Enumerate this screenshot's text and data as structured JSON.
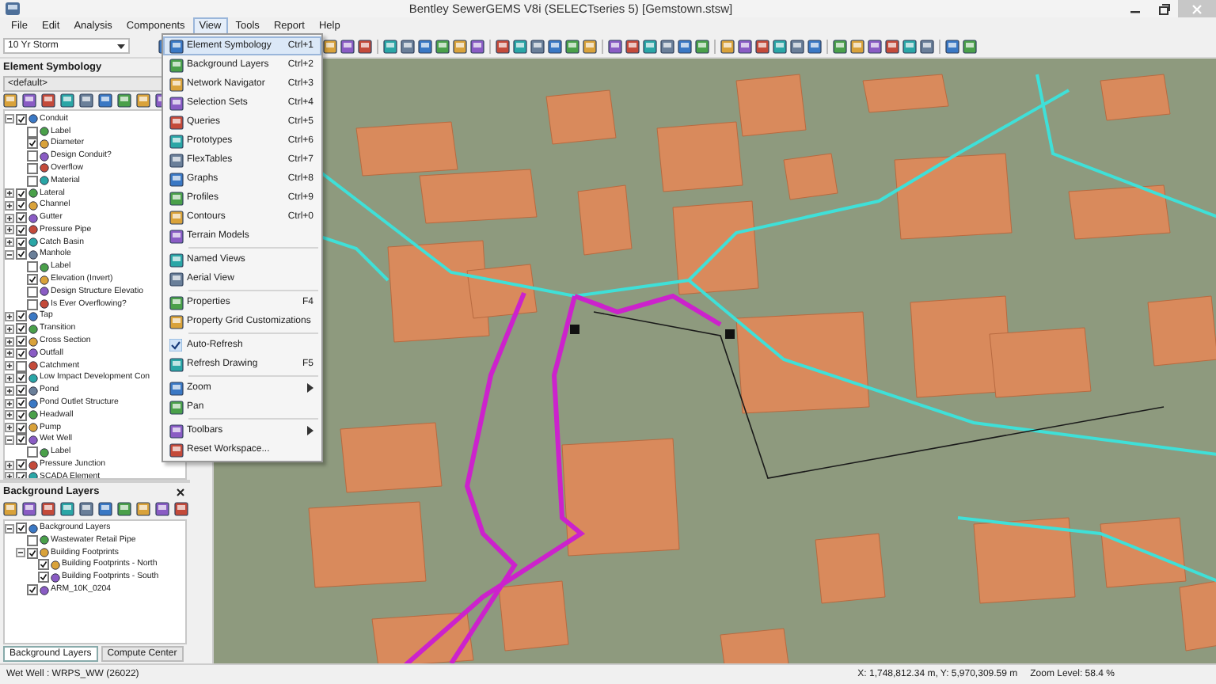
{
  "window": {
    "title": "Bentley SewerGEMS V8i (SELECTseries 5) [Gemstown.stsw]"
  },
  "menu_bar": [
    {
      "label": "File",
      "selected": false
    },
    {
      "label": "Edit",
      "selected": false
    },
    {
      "label": "Analysis",
      "selected": false
    },
    {
      "label": "Components",
      "selected": false
    },
    {
      "label": "View",
      "selected": true
    },
    {
      "label": "Tools",
      "selected": false
    },
    {
      "label": "Report",
      "selected": false
    },
    {
      "label": "Help",
      "selected": false
    }
  ],
  "scenario": {
    "value": "10 Yr Storm"
  },
  "view_menu": [
    {
      "kind": "item",
      "label": "Element Symbology",
      "shortcut": "Ctrl+1",
      "selected": true,
      "checked": false,
      "submenu": false
    },
    {
      "kind": "item",
      "label": "Background Layers",
      "shortcut": "Ctrl+2",
      "selected": false,
      "checked": false,
      "submenu": false
    },
    {
      "kind": "item",
      "label": "Network Navigator",
      "shortcut": "Ctrl+3",
      "selected": false,
      "checked": false,
      "submenu": false
    },
    {
      "kind": "item",
      "label": "Selection Sets",
      "shortcut": "Ctrl+4",
      "selected": false,
      "checked": false,
      "submenu": false
    },
    {
      "kind": "item",
      "label": "Queries",
      "shortcut": "Ctrl+5",
      "selected": false,
      "checked": false,
      "submenu": false
    },
    {
      "kind": "item",
      "label": "Prototypes",
      "shortcut": "Ctrl+6",
      "selected": false,
      "checked": false,
      "submenu": false
    },
    {
      "kind": "item",
      "label": "FlexTables",
      "shortcut": "Ctrl+7",
      "selected": false,
      "checked": false,
      "submenu": false
    },
    {
      "kind": "item",
      "label": "Graphs",
      "shortcut": "Ctrl+8",
      "selected": false,
      "checked": false,
      "submenu": false
    },
    {
      "kind": "item",
      "label": "Profiles",
      "shortcut": "Ctrl+9",
      "selected": false,
      "checked": false,
      "submenu": false
    },
    {
      "kind": "item",
      "label": "Contours",
      "shortcut": "Ctrl+0",
      "selected": false,
      "checked": false,
      "submenu": false
    },
    {
      "kind": "item",
      "label": "Terrain Models",
      "selected": false,
      "checked": false,
      "submenu": false
    },
    {
      "kind": "separator"
    },
    {
      "kind": "item",
      "label": "Named Views",
      "selected": false,
      "checked": false,
      "submenu": false
    },
    {
      "kind": "item",
      "label": "Aerial View",
      "selected": false,
      "checked": false,
      "submenu": false
    },
    {
      "kind": "separator"
    },
    {
      "kind": "item",
      "label": "Properties",
      "shortcut": "F4",
      "selected": false,
      "checked": false,
      "submenu": false
    },
    {
      "kind": "item",
      "label": "Property Grid Customizations",
      "selected": false,
      "checked": false,
      "submenu": false
    },
    {
      "kind": "separator"
    },
    {
      "kind": "item",
      "label": "Auto-Refresh",
      "selected": false,
      "checked": true,
      "submenu": false
    },
    {
      "kind": "item",
      "label": "Refresh Drawing",
      "shortcut": "F5",
      "selected": false,
      "checked": false,
      "submenu": false
    },
    {
      "kind": "separator"
    },
    {
      "kind": "item",
      "label": "Zoom",
      "selected": false,
      "checked": false,
      "submenu": true
    },
    {
      "kind": "item",
      "label": "Pan",
      "selected": false,
      "checked": false,
      "submenu": false
    },
    {
      "kind": "separator"
    },
    {
      "kind": "item",
      "label": "Toolbars",
      "selected": false,
      "checked": false,
      "submenu": true
    },
    {
      "kind": "item",
      "label": "Reset Workspace...",
      "selected": false,
      "checked": false,
      "submenu": false
    }
  ],
  "element_symbology": {
    "title": "Element Symbology",
    "dropdown": {
      "value": "<default>"
    },
    "tree": [
      {
        "label": "Conduit",
        "checked": true,
        "expanded": true,
        "children": [
          {
            "label": "Label",
            "checked": false
          },
          {
            "label": "Diameter",
            "checked": true
          },
          {
            "label": "Design Conduit?",
            "checked": false
          },
          {
            "label": "Overflow",
            "checked": false
          },
          {
            "label": "Material",
            "checked": false
          }
        ]
      },
      {
        "label": "Lateral",
        "checked": true,
        "expanded": false
      },
      {
        "label": "Channel",
        "checked": true,
        "expanded": false
      },
      {
        "label": "Gutter",
        "checked": true,
        "expanded": false
      },
      {
        "label": "Pressure Pipe",
        "checked": true,
        "expanded": false
      },
      {
        "label": "Catch Basin",
        "checked": true,
        "expanded": false
      },
      {
        "label": "Manhole",
        "checked": true,
        "expanded": true,
        "children": [
          {
            "label": "Label",
            "checked": false
          },
          {
            "label": "Elevation (Invert)",
            "checked": true
          },
          {
            "label": "Design Structure Elevatio",
            "checked": false
          },
          {
            "label": "Is Ever Overflowing?",
            "checked": false
          }
        ]
      },
      {
        "label": "Tap",
        "checked": true,
        "expanded": false
      },
      {
        "label": "Transition",
        "checked": true,
        "expanded": false
      },
      {
        "label": "Cross Section",
        "checked": true,
        "expanded": false
      },
      {
        "label": "Outfall",
        "checked": true,
        "expanded": false
      },
      {
        "label": "Catchment",
        "checked": false,
        "expanded": false
      },
      {
        "label": "Low Impact Development Con",
        "checked": true,
        "expanded": false
      },
      {
        "label": "Pond",
        "checked": true,
        "expanded": false
      },
      {
        "label": "Pond Outlet Structure",
        "checked": true,
        "expanded": false
      },
      {
        "label": "Headwall",
        "checked": true,
        "expanded": false
      },
      {
        "label": "Pump",
        "checked": true,
        "expanded": false
      },
      {
        "label": "Wet Well",
        "checked": true,
        "expanded": true,
        "children": [
          {
            "label": "Label",
            "checked": false
          }
        ]
      },
      {
        "label": "Pressure Junction",
        "checked": true,
        "expanded": false
      },
      {
        "label": "SCADA Element",
        "checked": true,
        "expanded": false
      }
    ]
  },
  "background_layers": {
    "title": "Background Layers",
    "tree": [
      {
        "label": "Background Layers",
        "checked": true,
        "expanded": true,
        "children": [
          {
            "label": "Wastewater Retail Pipe",
            "checked": false
          },
          {
            "label": "Building Footprints",
            "checked": true,
            "expanded": true,
            "children": [
              {
                "label": "Building Footprints - North",
                "checked": true
              },
              {
                "label": "Building Footprints - South",
                "checked": true
              }
            ]
          },
          {
            "label": "ARM_10K_0204",
            "checked": true
          }
        ]
      }
    ]
  },
  "panel_tabs": [
    {
      "label": "Background Layers",
      "selected": true
    },
    {
      "label": "Compute Center",
      "selected": false
    }
  ],
  "status_bar": {
    "element": "Wet Well : WRPS_WW (26022)",
    "coordinates": "X: 1,748,812.34 m, Y: 5,970,309.59 m",
    "zoom": "Zoom Level: 58.4 %"
  }
}
